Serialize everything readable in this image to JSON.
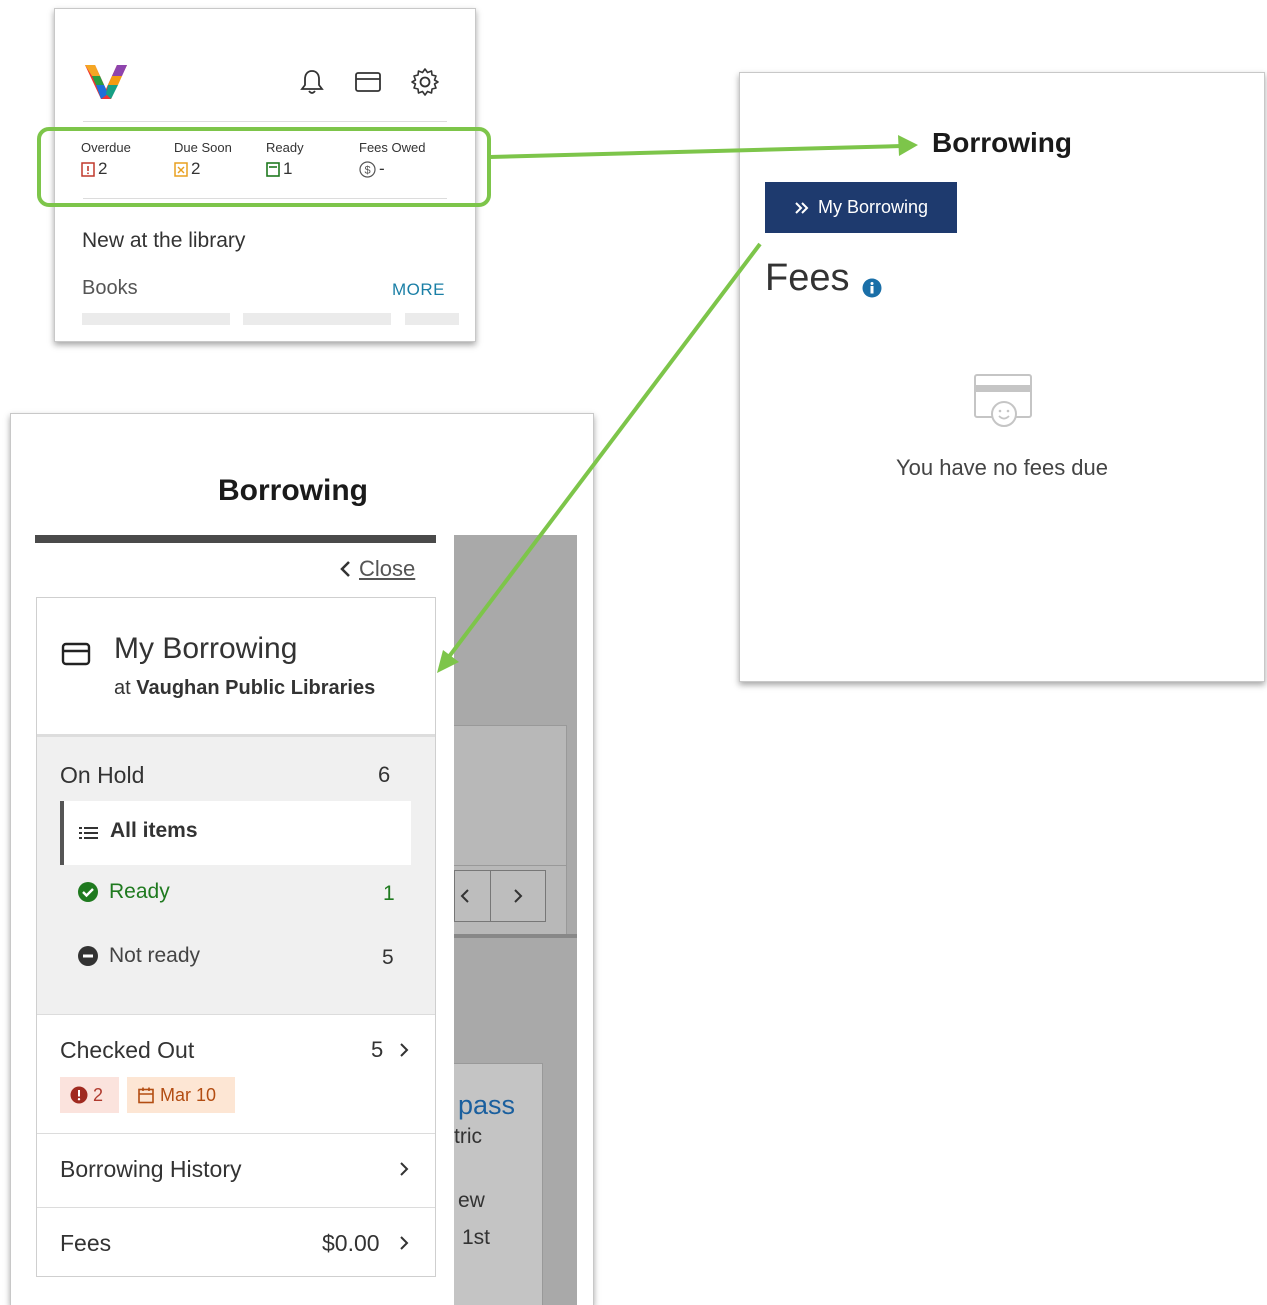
{
  "dashboard": {
    "stats": [
      {
        "label": "Overdue",
        "value": "2"
      },
      {
        "label": "Due Soon",
        "value": "2"
      },
      {
        "label": "Ready",
        "value": "1"
      },
      {
        "label": "Fees Owed",
        "value": "-"
      }
    ],
    "new_title": "New at the library",
    "books_label": "Books",
    "more_label": "MORE"
  },
  "fees_card": {
    "title": "Borrowing",
    "my_borrowing_button": "My Borrowing",
    "fees_heading": "Fees",
    "no_fees_text": "You have no fees due"
  },
  "borrowing_panel": {
    "title": "Borrowing",
    "close_label": "Close",
    "my_borrowing_title": "My Borrowing",
    "at_label": "at",
    "library_name": "Vaughan Public Libraries",
    "on_hold": {
      "label": "On Hold",
      "count": "6"
    },
    "all_items": "All items",
    "ready": {
      "label": "Ready",
      "count": "1"
    },
    "not_ready": {
      "label": "Not ready",
      "count": "5"
    },
    "checked_out": {
      "label": "Checked Out",
      "count": "5",
      "overdue_badge": "2",
      "due_badge": "Mar 10"
    },
    "history": {
      "label": "Borrowing History"
    },
    "fees": {
      "label": "Fees",
      "amount": "$0.00"
    },
    "background_fragments": [
      "pass",
      "tric",
      "ew",
      "1st"
    ]
  },
  "colors": {
    "accent_green": "#7dc54a",
    "button_navy": "#1e3a6e",
    "link_blue": "#1a7fa6",
    "ready_green": "#1f7a1f",
    "overdue_red": "#c0392b",
    "due_soon_orange": "#e8a020",
    "badge_red_bg": "#fbe3dd",
    "badge_orange_bg": "#fde6d4"
  }
}
